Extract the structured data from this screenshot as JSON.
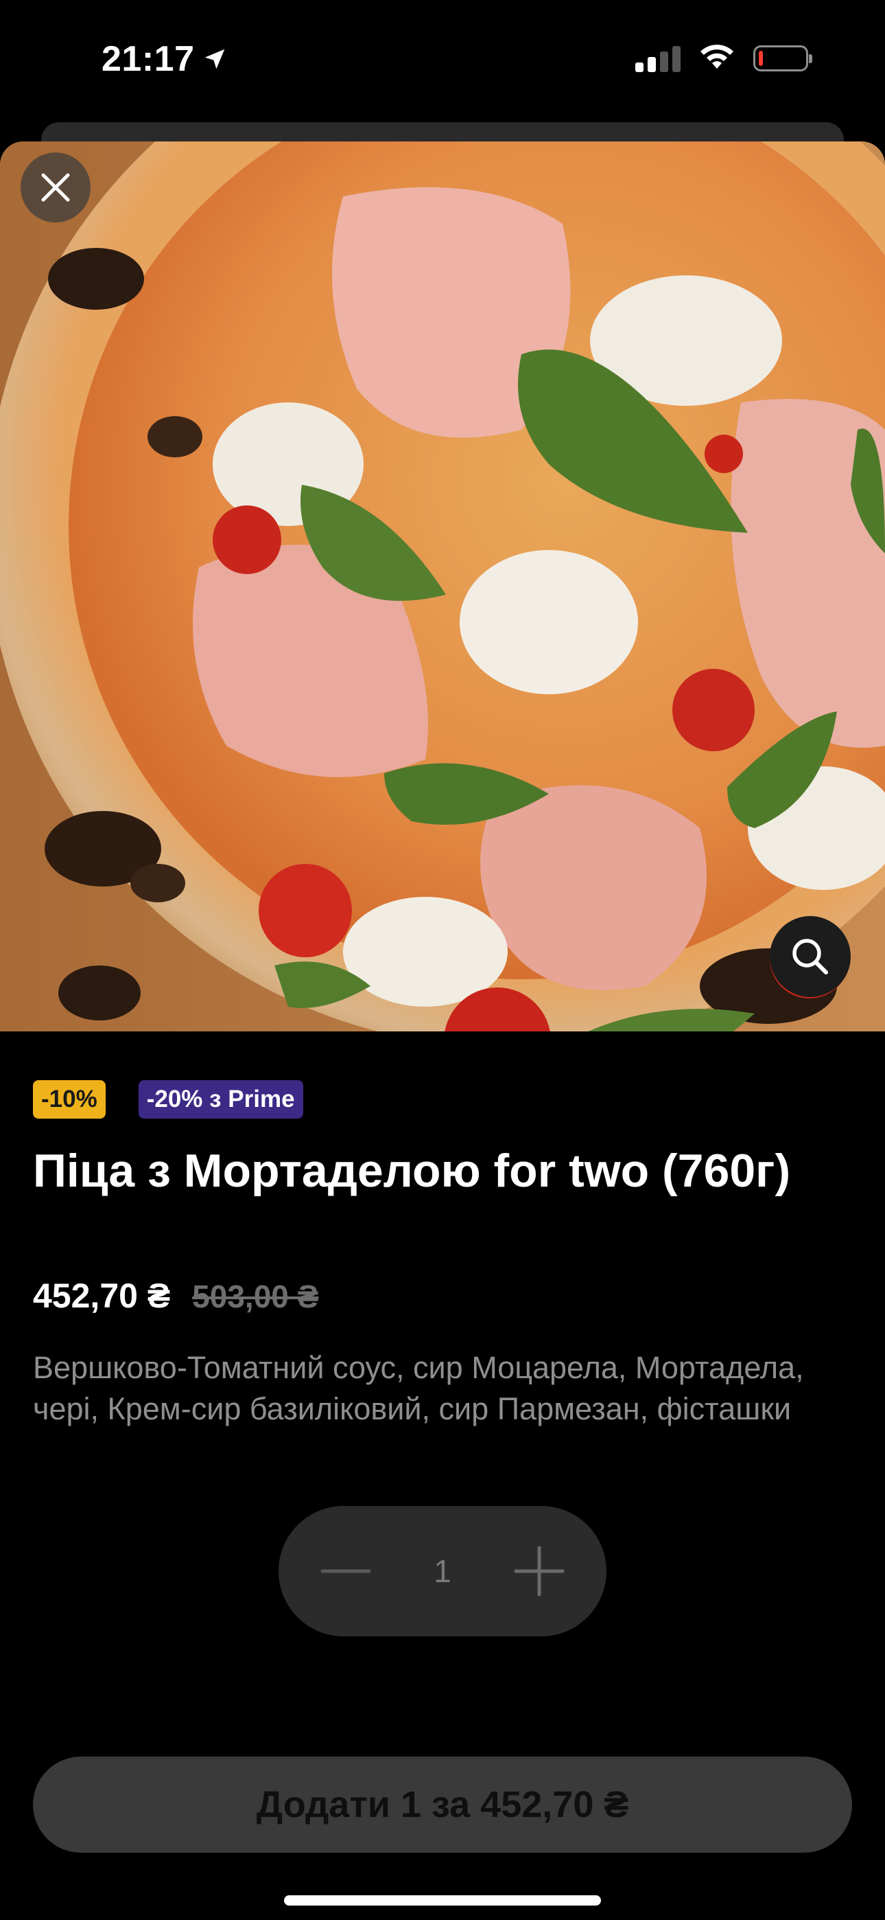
{
  "status_bar": {
    "time": "21:17",
    "icons": [
      "location-arrow-icon",
      "cellular-signal-icon",
      "wifi-icon",
      "battery-low-icon"
    ],
    "battery_color": "#ff3b30"
  },
  "product": {
    "image_alt": "pizza-photo",
    "badges": {
      "discount": "-10%",
      "prime": "-20% з Prime"
    },
    "title": "Піца з Мортаделою for two (760г)",
    "price_current": "452,70 ₴",
    "price_old": "503,00 ₴",
    "description": "Вершково-Томатний соус, сир Моцарела, Мортадела, чері, Крем-сир базиліковий, сир Пармезан, фісташки"
  },
  "quantity": {
    "value": "1",
    "minus_icon": "minus-icon",
    "plus_icon": "plus-icon"
  },
  "add_button": {
    "label": "Додати 1 за 452,70 ₴"
  },
  "controls": {
    "close_icon": "close-icon",
    "zoom_icon": "search-icon"
  },
  "colors": {
    "background": "#000000",
    "discount_badge": "#f0b21a",
    "prime_badge": "#3c2a86",
    "button_bg": "#3a3a3a",
    "stepper_bg": "#2b2b2b"
  }
}
